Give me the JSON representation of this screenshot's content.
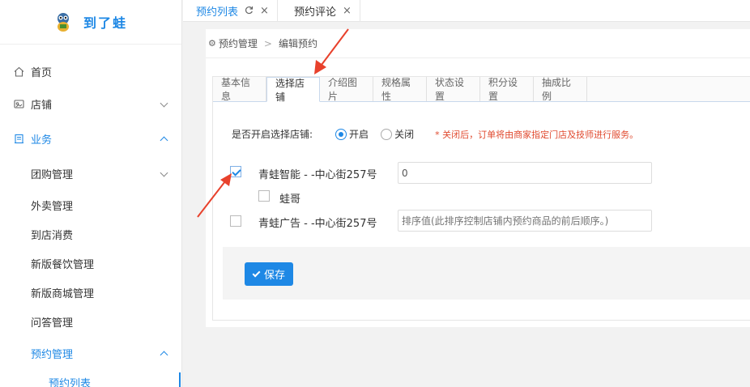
{
  "sidebar": {
    "brand": "到了蛙",
    "menu": [
      {
        "label": "首页"
      },
      {
        "label": "店铺"
      },
      {
        "label": "业务"
      }
    ],
    "submenu": [
      {
        "label": "团购管理"
      },
      {
        "label": "外卖管理"
      },
      {
        "label": "到店消费"
      },
      {
        "label": "新版餐饮管理"
      },
      {
        "label": "新版商城管理"
      },
      {
        "label": "问答管理"
      },
      {
        "label": "预约管理"
      }
    ],
    "subsub": [
      {
        "label": "预约列表"
      }
    ]
  },
  "top_tabs": [
    {
      "label": "预约列表",
      "refresh_icon": "C",
      "close_icon": "×"
    },
    {
      "label": "预约评论",
      "close_icon": "×"
    }
  ],
  "breadcrumb": {
    "parent": "预约管理",
    "separator": ">",
    "current": "编辑预约"
  },
  "tabs": [
    {
      "label": "基本信息"
    },
    {
      "label": "选择店铺"
    },
    {
      "label": "介绍图片"
    },
    {
      "label": "规格属性"
    },
    {
      "label": "状态设置"
    },
    {
      "label": "积分设置"
    },
    {
      "label": "抽成比例"
    }
  ],
  "form": {
    "store_select_label": "是否开启选择店铺:",
    "option_on": "开启",
    "option_off": "关闭",
    "selected": "开启",
    "hint": "* 关闭后，订单将由商家指定门店及技师进行服务。",
    "stores": [
      {
        "name": "青蛙智能 - -中心街257号",
        "checked": true,
        "value": "0",
        "placeholder": ""
      },
      {
        "name": "蛙哥",
        "checked": false
      },
      {
        "name": "青蛙广告 - -中心街257号",
        "checked": false,
        "value": "",
        "placeholder": "排序值(此排序控制店铺内预约商品的前后顺序。)"
      }
    ],
    "save_label": "保存"
  },
  "colors": {
    "accent": "#1e88e5",
    "hint": "#e04a2f",
    "annotation_arrow": "#e8412c"
  }
}
